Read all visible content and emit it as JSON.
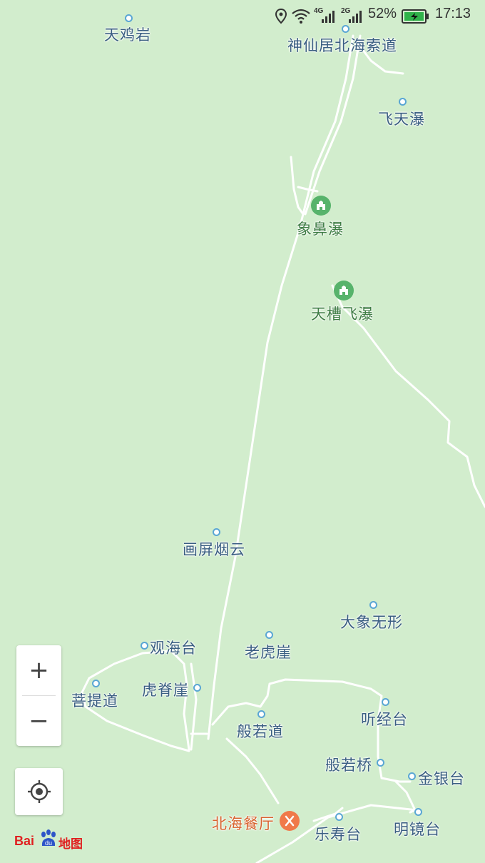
{
  "status_bar": {
    "net_4g": "4G",
    "net_2g": "2G",
    "battery": "52%",
    "time": "17:13",
    "icons": [
      "location-icon",
      "wifi-icon",
      "signal-icon",
      "battery-icon"
    ]
  },
  "map": {
    "background": "#d2edcd",
    "road_color": "#ffffff",
    "poi_dot_color": "#5aa6d4",
    "label_color": "#3a5e82",
    "scenic_color": "#57b36b",
    "restaurant_color": "#f07a4a",
    "pois": {
      "tianjiyan": "天鸡岩",
      "shenxianju": "神仙居北海索道",
      "feitianpu": "飞天瀑",
      "xiangbipu": "象鼻瀑",
      "tiancaofeipu": "天槽飞瀑",
      "huapingyanyun": "画屏烟云",
      "daxiangwuxing": "大象无形",
      "guanhaitai": "观海台",
      "laohuya": "老虎崖",
      "putidao": "菩提道",
      "hujiya": "虎脊崖",
      "tingjingtai": "听经台",
      "boruodao": "般若道",
      "boruoqiao": "般若桥",
      "jinyintai": "金银台",
      "beihaicanting": "北海餐厅",
      "leshoutai": "乐寿台",
      "mingjingtai": "明镜台"
    }
  },
  "controls": {
    "zoom_in": "+",
    "zoom_out": "−"
  },
  "logo": {
    "bai": "Bai",
    "du": "du",
    "map_text": "地图"
  }
}
